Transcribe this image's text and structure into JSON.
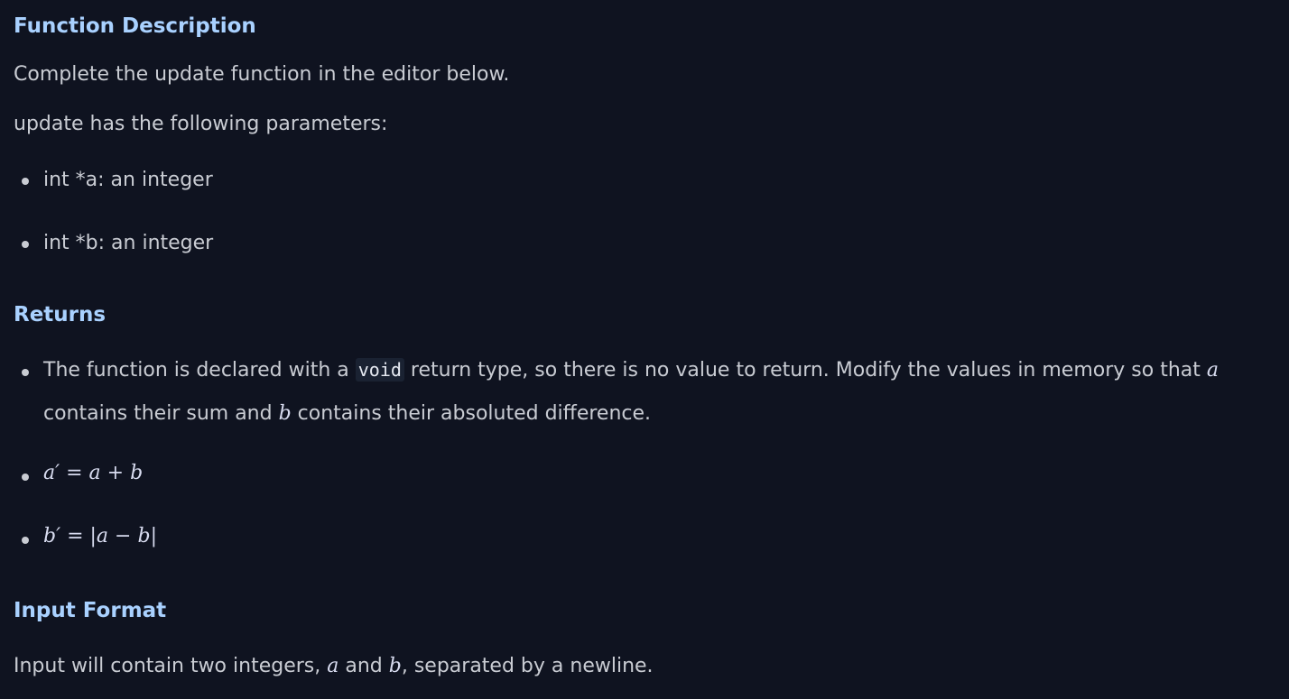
{
  "function_description": {
    "heading": "Function Description",
    "intro": "Complete the update function in the editor below.",
    "params_intro": "update has the following parameters:",
    "params": [
      "int *a: an integer",
      "int *b: an integer"
    ]
  },
  "returns": {
    "heading": "Returns",
    "line1_pre": "The function is declared with a ",
    "code": "void",
    "line1_post": " return type, so there is no value to return. Modify the values in memory so that ",
    "var_a": "a",
    "line2_pre": "contains their sum and ",
    "var_b": "b",
    "line2_post": " contains their absoluted difference.",
    "formula1": {
      "lhs": "a′",
      "eq": " = ",
      "rhs_a": "a",
      "op": " + ",
      "rhs_b": "b"
    },
    "formula2": {
      "lhs": "b′",
      "eq": " = ",
      "bar_open": "|",
      "rhs_a": "a",
      "op": " − ",
      "rhs_b": "b",
      "bar_close": "|"
    }
  },
  "input_format": {
    "heading": "Input Format",
    "text_pre": "Input will contain two integers, ",
    "var_a": "a",
    "text_mid": " and ",
    "var_b": "b",
    "text_post": ", separated by a newline."
  }
}
